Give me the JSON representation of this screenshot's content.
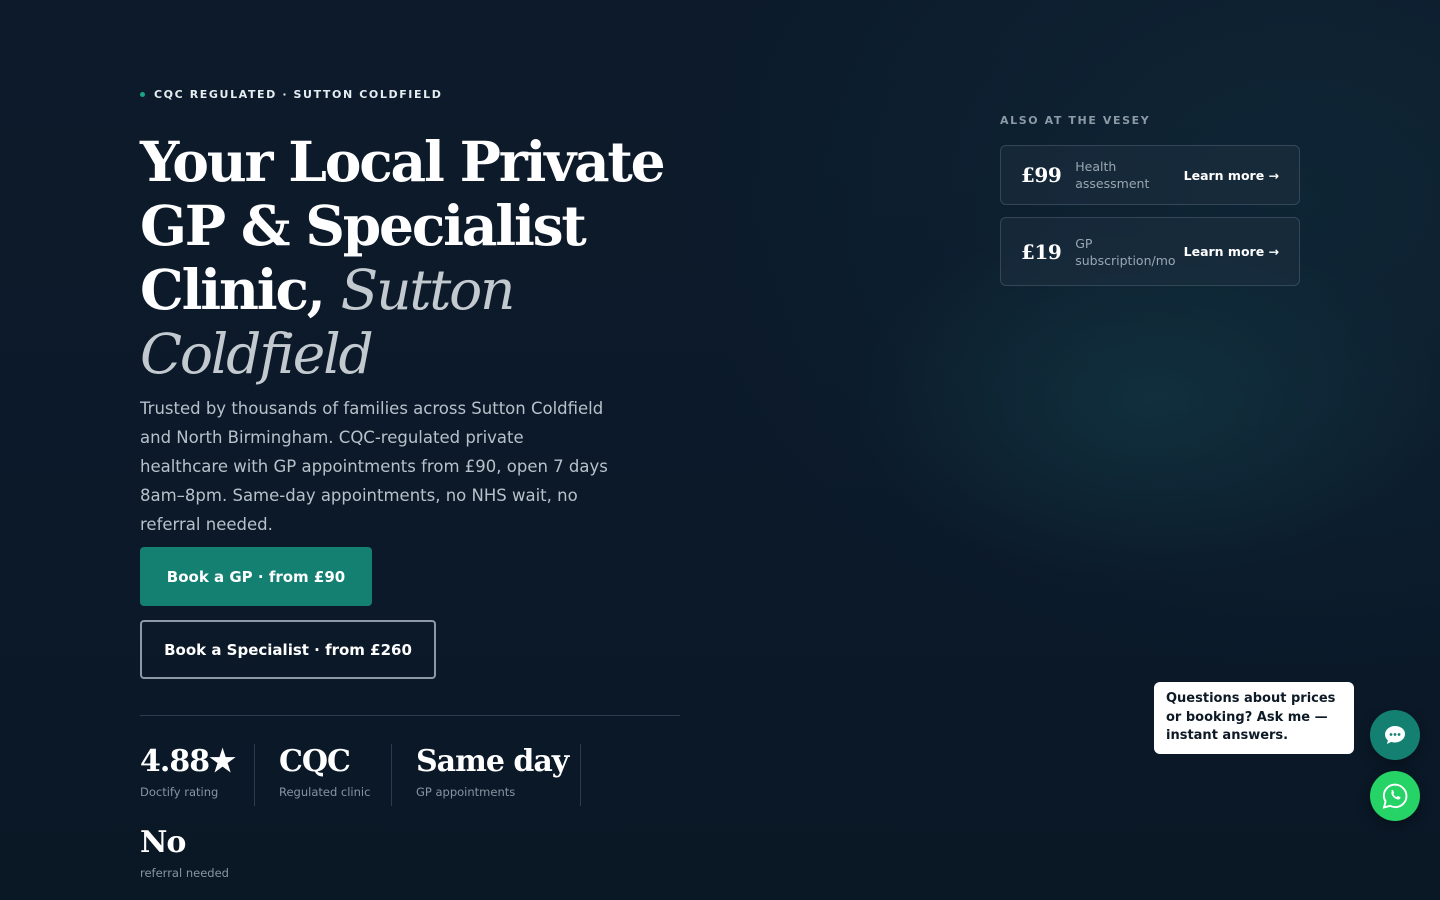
{
  "hero": {
    "eyebrow": "CQC REGULATED · SUTTON COLDFIELD",
    "title_line1": "Your Local Private",
    "title_line2": "GP & Specialist",
    "title_line3": "Clinic,",
    "title_accent1": "Sutton",
    "title_accent2": "Coldfield",
    "lead": "Trusted by thousands of families across Sutton Coldfield and North Birmingham. CQC-regulated private healthcare with GP appointments from £90, open 7 days 8am–8pm. Same-day appointments, no NHS wait, no referral needed.",
    "primary_cta": "Book a GP · from £90",
    "secondary_cta": "Book a Specialist · from £260"
  },
  "stats": [
    {
      "value": "4.88★",
      "label": "Doctify rating"
    },
    {
      "value": "CQC",
      "label": "Regulated clinic"
    },
    {
      "value": "Same day",
      "label": "GP appointments"
    },
    {
      "value": "No",
      "label": "referral needed"
    }
  ],
  "aside": {
    "title": "ALSO AT THE VESEY",
    "cards": [
      {
        "price": "£99",
        "desc": "Health assessment",
        "link": "Learn more →"
      },
      {
        "price": "£19",
        "desc": "GP subscription/mo",
        "link": "Learn more →"
      }
    ]
  },
  "chat": {
    "prompt": "Questions about prices or booking? Ask me — instant answers."
  },
  "colors": {
    "accent": "#148072",
    "whatsapp": "#25d366",
    "background": "#0b1929"
  },
  "icons": {
    "chat": "chat-dots-icon",
    "whatsapp": "whatsapp-icon"
  }
}
